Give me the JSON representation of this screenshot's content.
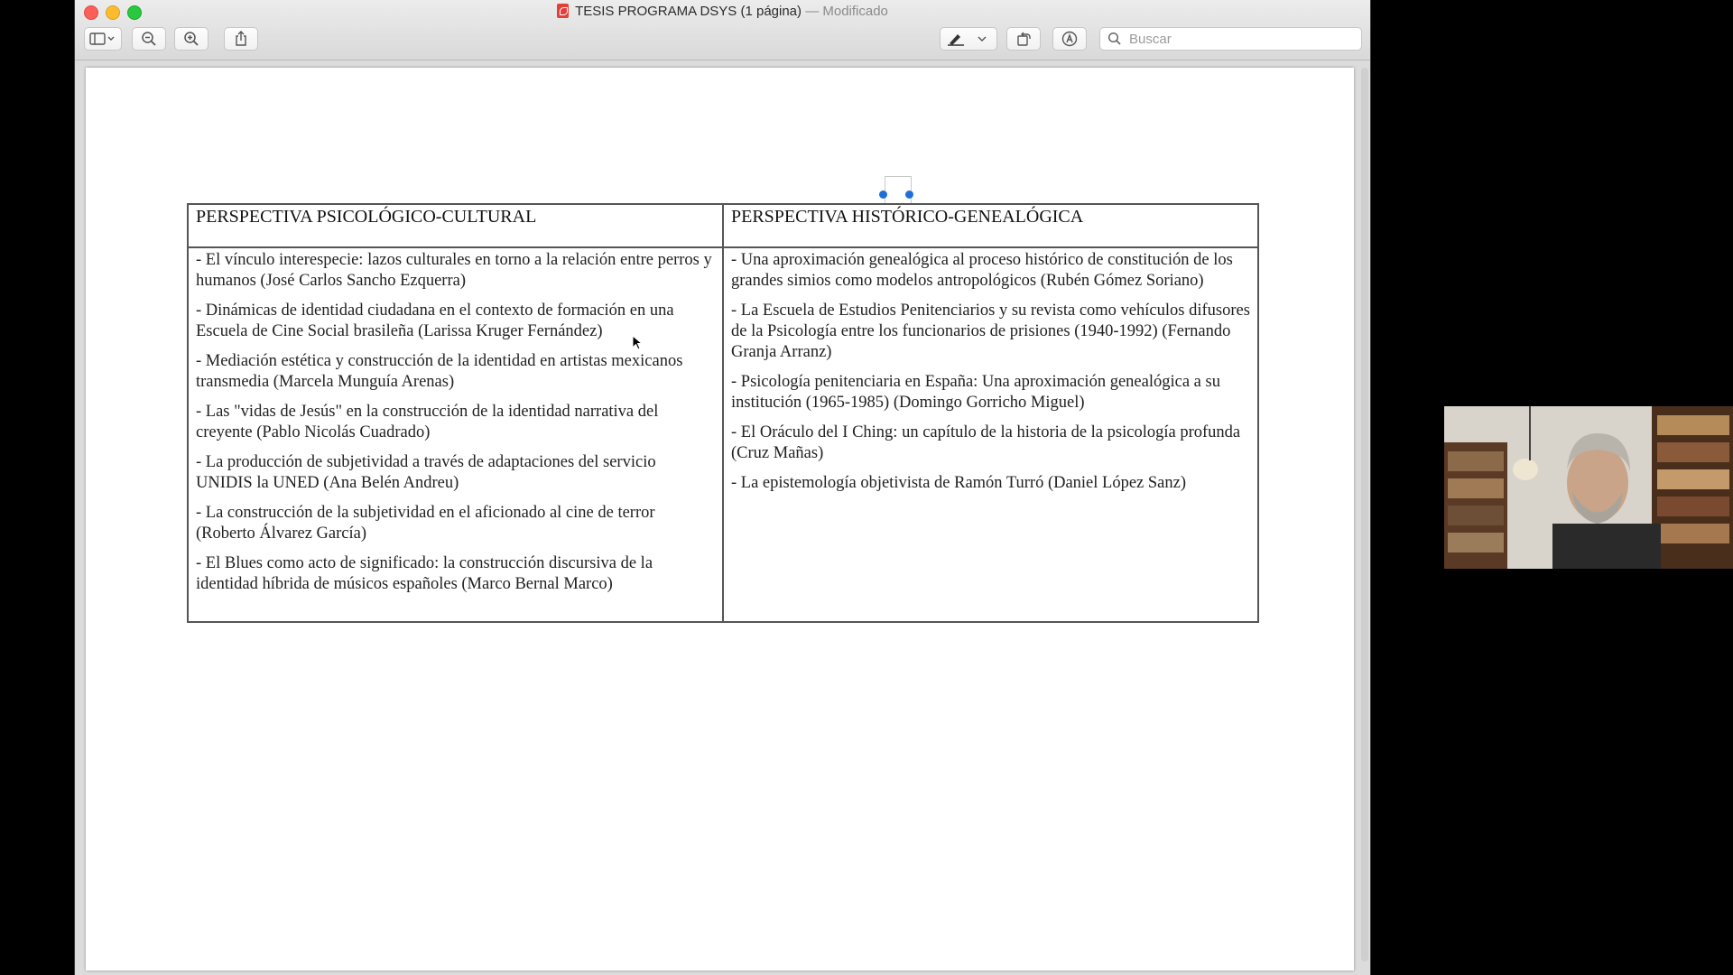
{
  "window": {
    "title": "TESIS PROGRAMA DSYS (1 página)",
    "title_status": "— Modificado"
  },
  "toolbar": {
    "buttons": [
      "sidebar-icon",
      "zoom-out-icon",
      "zoom-in-icon",
      "share-icon",
      "markup-pen-icon",
      "rotate-icon",
      "annotate-icon"
    ],
    "search_placeholder": "Buscar"
  },
  "document": {
    "left_column": {
      "header": "PERSPECTIVA PSICOLÓGICO-CULTURAL",
      "items": [
        "- El vínculo interespecie: lazos culturales en torno a la relación entre perros y humanos (José Carlos Sancho Ezquerra)",
        "- Dinámicas de identidad ciudadana en el contexto de formación en una Escuela de Cine Social brasileña (Larissa Kruger Fernández)",
        "- Mediación estética y construcción de la identidad en artistas mexicanos transmedia (Marcela Munguía Arenas)",
        "- Las \"vidas de Jesús\" en la construcción de la identidad narrativa del creyente (Pablo Nicolás Cuadrado)",
        "- La producción de subjetividad a través de adaptaciones del servicio UNIDIS la UNED (Ana Belén Andreu)",
        "- La construcción de la subjetividad en el aficionado al cine de terror (Roberto Álvarez García)",
        "- El Blues como acto de significado: la construcción discursiva de la identidad híbrida de músicos españoles (Marco Bernal Marco)"
      ]
    },
    "right_column": {
      "header": "PERSPECTIVA HISTÓRICO-GENEALÓGICA",
      "items": [
        "- Una aproximación genealógica al proceso histórico de constitución de los grandes simios como modelos antropológicos (Rubén Gómez Soriano)",
        "- La Escuela de Estudios Penitenciarios y su revista como vehículos difusores de la Psicología entre los funcionarios de prisiones (1940-1992) (Fernando Granja Arranz)",
        "- Psicología penitenciaria en España: Una aproximación genealógica a su institución (1965-1985) (Domingo Gorricho Miguel)",
        "- El Oráculo del I Ching: un capítulo de la historia de la psicología profunda (Cruz Mañas)",
        "- La epistemología objetivista de Ramón Turró (Daniel López Sanz)"
      ]
    }
  },
  "colors": {
    "close": "#fc5f57",
    "minimize": "#fdbc2e",
    "maximize": "#28c840",
    "selection_handle": "#1f6fd6"
  }
}
